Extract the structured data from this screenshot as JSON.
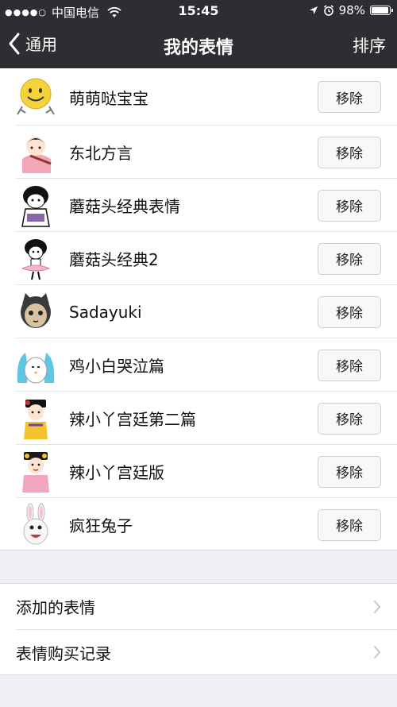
{
  "status": {
    "carrier": "中国电信",
    "time": "15:45",
    "battery": "98%",
    "battery_level": 0.98,
    "signal_dots": "●●●●○"
  },
  "nav": {
    "back_label": "通用",
    "title": "我的表情",
    "right_action": "排序"
  },
  "packs": [
    {
      "name": "萌萌哒宝宝",
      "icon": "smiley-icon"
    },
    {
      "name": "东北方言",
      "icon": "girl-flute-icon"
    },
    {
      "name": "蘑菇头经典表情",
      "icon": "mushroom-head-icon"
    },
    {
      "name": "蘑菇头经典2",
      "icon": "mushroom-head-ballet-icon"
    },
    {
      "name": "Sadayuki",
      "icon": "cat-face-icon"
    },
    {
      "name": "鸡小白哭泣篇",
      "icon": "crying-chick-icon"
    },
    {
      "name": "辣小丫宫廷第二篇",
      "icon": "palace-girl-icon"
    },
    {
      "name": "辣小丫宫廷版",
      "icon": "palace-girl-pink-icon"
    },
    {
      "name": "疯狂兔子",
      "icon": "rabbid-icon"
    }
  ],
  "remove_label": "移除",
  "settings": [
    {
      "label": "添加的表情"
    },
    {
      "label": "表情购买记录"
    }
  ],
  "colors": {
    "navbar": "#2e2e32",
    "background": "#efeff4"
  }
}
